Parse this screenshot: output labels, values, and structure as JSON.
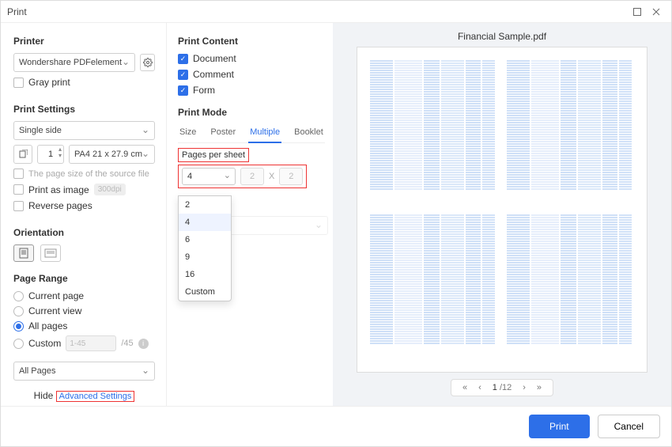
{
  "window": {
    "title": "Print"
  },
  "printer": {
    "label": "Printer",
    "name": "Wondershare PDFelement",
    "gray_print": "Gray print"
  },
  "print_settings": {
    "label": "Print Settings",
    "mode": "Single side",
    "copies": "1",
    "paper": "PA4 21 x 27.9 cm",
    "source_file": "The page size of the source file",
    "print_as_image": "Print as image",
    "dpi": "300dpi",
    "reverse_pages": "Reverse pages"
  },
  "orientation": {
    "label": "Orientation"
  },
  "page_range": {
    "label": "Page Range",
    "current_page": "Current page",
    "current_view": "Current view",
    "all_pages": "All pages",
    "custom": "Custom",
    "custom_placeholder": "1-45",
    "custom_total": "/45",
    "subset": "All Pages"
  },
  "advanced": {
    "hide": "Hide",
    "link": "Advanced Settings"
  },
  "print_content": {
    "label": "Print Content",
    "document": "Document",
    "comment": "Comment",
    "form": "Form"
  },
  "print_mode": {
    "label": "Print Mode",
    "tabs": {
      "size": "Size",
      "poster": "Poster",
      "multiple": "Multiple",
      "booklet": "Booklet"
    },
    "pages_per_sheet": "Pages per sheet",
    "pps_value": "4",
    "dim_a": "2",
    "dim_x": "X",
    "dim_b": "2",
    "options": [
      "2",
      "4",
      "6",
      "9",
      "16",
      "Custom"
    ]
  },
  "preview": {
    "filename": "Financial Sample.pdf",
    "page": "1",
    "total": "/12"
  },
  "footer": {
    "print": "Print",
    "cancel": "Cancel"
  }
}
